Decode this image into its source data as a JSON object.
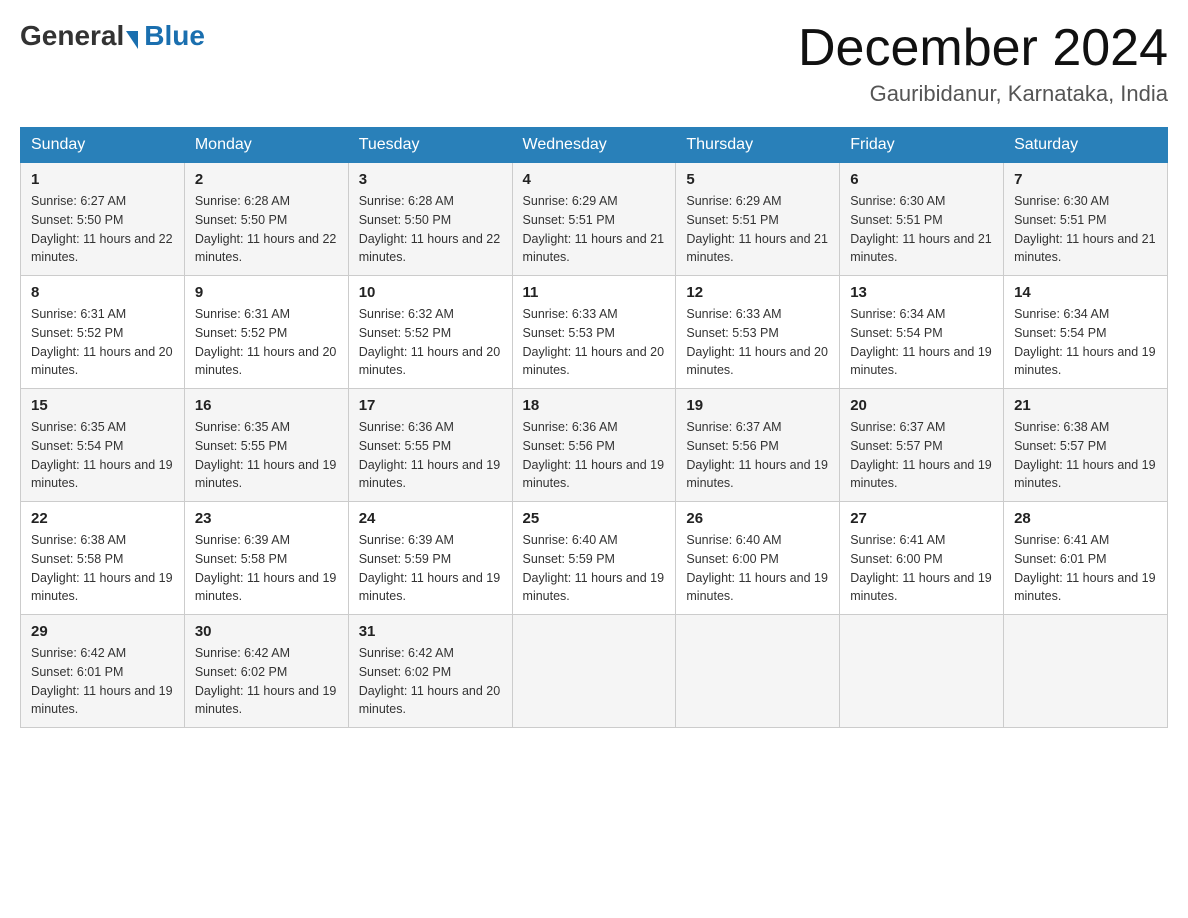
{
  "logo": {
    "general": "General",
    "blue": "Blue",
    "tagline": "Blue"
  },
  "header": {
    "month": "December 2024",
    "location": "Gauribidanur, Karnataka, India"
  },
  "weekdays": [
    "Sunday",
    "Monday",
    "Tuesday",
    "Wednesday",
    "Thursday",
    "Friday",
    "Saturday"
  ],
  "weeks": [
    [
      {
        "day": "1",
        "sunrise": "6:27 AM",
        "sunset": "5:50 PM",
        "daylight": "11 hours and 22 minutes."
      },
      {
        "day": "2",
        "sunrise": "6:28 AM",
        "sunset": "5:50 PM",
        "daylight": "11 hours and 22 minutes."
      },
      {
        "day": "3",
        "sunrise": "6:28 AM",
        "sunset": "5:50 PM",
        "daylight": "11 hours and 22 minutes."
      },
      {
        "day": "4",
        "sunrise": "6:29 AM",
        "sunset": "5:51 PM",
        "daylight": "11 hours and 21 minutes."
      },
      {
        "day": "5",
        "sunrise": "6:29 AM",
        "sunset": "5:51 PM",
        "daylight": "11 hours and 21 minutes."
      },
      {
        "day": "6",
        "sunrise": "6:30 AM",
        "sunset": "5:51 PM",
        "daylight": "11 hours and 21 minutes."
      },
      {
        "day": "7",
        "sunrise": "6:30 AM",
        "sunset": "5:51 PM",
        "daylight": "11 hours and 21 minutes."
      }
    ],
    [
      {
        "day": "8",
        "sunrise": "6:31 AM",
        "sunset": "5:52 PM",
        "daylight": "11 hours and 20 minutes."
      },
      {
        "day": "9",
        "sunrise": "6:31 AM",
        "sunset": "5:52 PM",
        "daylight": "11 hours and 20 minutes."
      },
      {
        "day": "10",
        "sunrise": "6:32 AM",
        "sunset": "5:52 PM",
        "daylight": "11 hours and 20 minutes."
      },
      {
        "day": "11",
        "sunrise": "6:33 AM",
        "sunset": "5:53 PM",
        "daylight": "11 hours and 20 minutes."
      },
      {
        "day": "12",
        "sunrise": "6:33 AM",
        "sunset": "5:53 PM",
        "daylight": "11 hours and 20 minutes."
      },
      {
        "day": "13",
        "sunrise": "6:34 AM",
        "sunset": "5:54 PM",
        "daylight": "11 hours and 19 minutes."
      },
      {
        "day": "14",
        "sunrise": "6:34 AM",
        "sunset": "5:54 PM",
        "daylight": "11 hours and 19 minutes."
      }
    ],
    [
      {
        "day": "15",
        "sunrise": "6:35 AM",
        "sunset": "5:54 PM",
        "daylight": "11 hours and 19 minutes."
      },
      {
        "day": "16",
        "sunrise": "6:35 AM",
        "sunset": "5:55 PM",
        "daylight": "11 hours and 19 minutes."
      },
      {
        "day": "17",
        "sunrise": "6:36 AM",
        "sunset": "5:55 PM",
        "daylight": "11 hours and 19 minutes."
      },
      {
        "day": "18",
        "sunrise": "6:36 AM",
        "sunset": "5:56 PM",
        "daylight": "11 hours and 19 minutes."
      },
      {
        "day": "19",
        "sunrise": "6:37 AM",
        "sunset": "5:56 PM",
        "daylight": "11 hours and 19 minutes."
      },
      {
        "day": "20",
        "sunrise": "6:37 AM",
        "sunset": "5:57 PM",
        "daylight": "11 hours and 19 minutes."
      },
      {
        "day": "21",
        "sunrise": "6:38 AM",
        "sunset": "5:57 PM",
        "daylight": "11 hours and 19 minutes."
      }
    ],
    [
      {
        "day": "22",
        "sunrise": "6:38 AM",
        "sunset": "5:58 PM",
        "daylight": "11 hours and 19 minutes."
      },
      {
        "day": "23",
        "sunrise": "6:39 AM",
        "sunset": "5:58 PM",
        "daylight": "11 hours and 19 minutes."
      },
      {
        "day": "24",
        "sunrise": "6:39 AM",
        "sunset": "5:59 PM",
        "daylight": "11 hours and 19 minutes."
      },
      {
        "day": "25",
        "sunrise": "6:40 AM",
        "sunset": "5:59 PM",
        "daylight": "11 hours and 19 minutes."
      },
      {
        "day": "26",
        "sunrise": "6:40 AM",
        "sunset": "6:00 PM",
        "daylight": "11 hours and 19 minutes."
      },
      {
        "day": "27",
        "sunrise": "6:41 AM",
        "sunset": "6:00 PM",
        "daylight": "11 hours and 19 minutes."
      },
      {
        "day": "28",
        "sunrise": "6:41 AM",
        "sunset": "6:01 PM",
        "daylight": "11 hours and 19 minutes."
      }
    ],
    [
      {
        "day": "29",
        "sunrise": "6:42 AM",
        "sunset": "6:01 PM",
        "daylight": "11 hours and 19 minutes."
      },
      {
        "day": "30",
        "sunrise": "6:42 AM",
        "sunset": "6:02 PM",
        "daylight": "11 hours and 19 minutes."
      },
      {
        "day": "31",
        "sunrise": "6:42 AM",
        "sunset": "6:02 PM",
        "daylight": "11 hours and 20 minutes."
      },
      null,
      null,
      null,
      null
    ]
  ]
}
